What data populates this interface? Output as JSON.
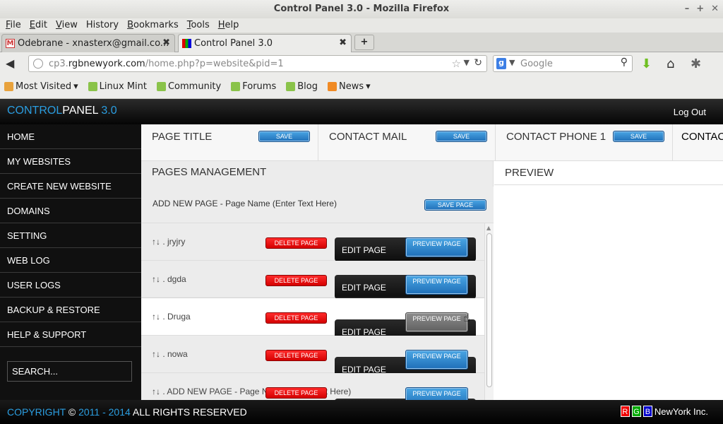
{
  "window": {
    "title": "Control Panel 3.0 - Mozilla Firefox",
    "controls": [
      "–",
      "+",
      "✕"
    ]
  },
  "menu": [
    {
      "key": "F",
      "rest": "ile"
    },
    {
      "key": "E",
      "rest": "dit"
    },
    {
      "key": "V",
      "rest": "iew"
    },
    {
      "key": "",
      "rest": "History"
    },
    {
      "key": "B",
      "rest": "ookmarks"
    },
    {
      "key": "T",
      "rest": "ools"
    },
    {
      "key": "H",
      "rest": "elp"
    }
  ],
  "tabs": [
    {
      "label": "Odebrane - xnasterx@gmail.co...",
      "close": "✖"
    },
    {
      "label": "Control Panel 3.0",
      "close": "✖"
    }
  ],
  "newtab": "+",
  "urlbar": {
    "domain_prefix": "cp3.",
    "domain": "rgbnewyork.com",
    "path": "/home.php?p=website&pid=1"
  },
  "search": {
    "placeholder": "Google",
    "engine": "g"
  },
  "bookmarks": [
    {
      "label": "Most Visited",
      "arrow": "▾"
    },
    {
      "label": "Linux Mint"
    },
    {
      "label": "Community"
    },
    {
      "label": "Forums"
    },
    {
      "label": "Blog"
    },
    {
      "label": "News",
      "arrow": "▾"
    }
  ],
  "cp": {
    "brand": {
      "part1": "CONTROL",
      "part2": "PANEL",
      "part3": " 3.0"
    },
    "logout": "Log Out"
  },
  "sidebar": {
    "items": [
      "HOME",
      "MY WEBSITES",
      "CREATE NEW WEBSITE",
      "DOMAINS",
      "SETTING",
      "WEB LOG",
      "USER LOGS",
      "BACKUP & RESTORE",
      "HELP & SUPPORT"
    ],
    "search_placeholder": "SEARCH..."
  },
  "topfields": [
    {
      "label": "PAGE TITLE",
      "button": "SAVE"
    },
    {
      "label": "CONTACT MAIL",
      "button": "SAVE"
    },
    {
      "label": "CONTACT PHONE 1",
      "button": "SAVE"
    },
    {
      "label": "CONTAC",
      "button": ""
    }
  ],
  "pages": {
    "title": "PAGES MANAGEMENT",
    "add_label": "ADD NEW PAGE - Page Name (Enter Text Here)",
    "save_page": "SAVE PAGE",
    "rows": [
      {
        "name": "↑↓ . jryjry",
        "delete": "DELETE PAGE",
        "edit": "EDIT PAGE",
        "preview": "PREVIEW PAGE"
      },
      {
        "name": "↑↓ . dgda",
        "delete": "DELETE PAGE",
        "edit": "EDIT PAGE",
        "preview": "PREVIEW PAGE"
      },
      {
        "name": "↑↓ . Druga",
        "delete": "DELETE PAGE",
        "edit": "EDIT PAGE",
        "preview": "PREVIEW PAGE"
      },
      {
        "name": "↑↓ . nowa",
        "delete": "DELETE PAGE",
        "edit": "EDIT PAGE",
        "preview": "PREVIEW PAGE"
      },
      {
        "name": "↑↓ . ADD NEW PAGE - Page Name (Enter Text Here)",
        "delete": "DELETE PAGE",
        "edit": "",
        "preview": "PREVIEW PAGE"
      }
    ]
  },
  "preview": {
    "title": "PREVIEW"
  },
  "footer": {
    "copyright": "COPYRIGHT",
    "symbol": " © ",
    "years": "2011 - 2014",
    "rights": " ALL RIGHTS RESERVED",
    "rgb": [
      "R",
      "G",
      "B"
    ],
    "company": "NewYork Inc."
  },
  "colors": {
    "accent": "#2a9de0",
    "danger": "#e00000",
    "dark": "#101010"
  }
}
